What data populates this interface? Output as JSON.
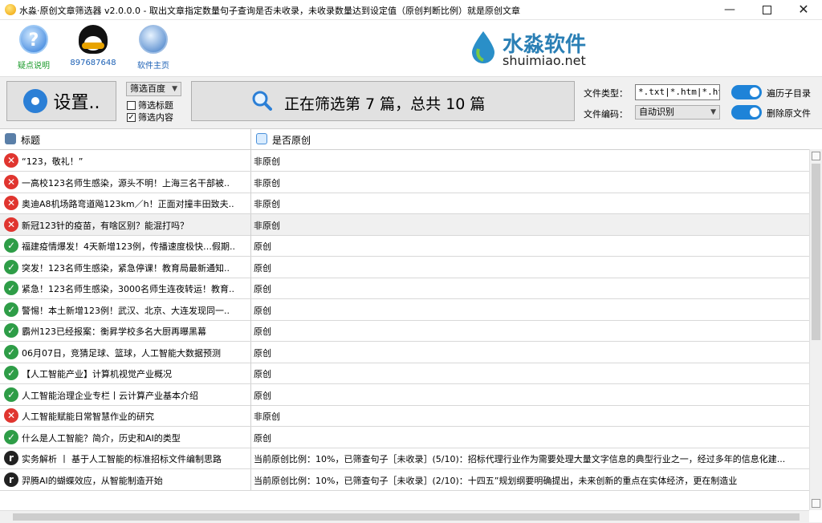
{
  "window": {
    "title": "水淼·原创文章筛选器 v2.0.0.0 - 取出文章指定数量句子查询是否未收录，未收录数量达到设定值（原创判断比例）就是原创文章"
  },
  "toolbar": {
    "items": [
      {
        "label": "疑点说明",
        "icon": "help-icon",
        "color": "#1a9a2a"
      },
      {
        "label": "897687648",
        "icon": "qq-penguin-icon",
        "color": "#1a5fb4"
      },
      {
        "label": "软件主页",
        "icon": "globe-icon",
        "color": "#1a5fb4"
      }
    ],
    "logo": {
      "cn": "水淼软件",
      "en": "shuimiao.net"
    }
  },
  "controls": {
    "settings_label": "设置..",
    "engine_select": "筛选百度",
    "check_title": {
      "label": "筛选标题",
      "checked": false,
      "mark": ""
    },
    "check_content": {
      "label": "筛选内容",
      "checked": true,
      "mark": "✓"
    },
    "status": "正在筛选第 7 篇，总共 10 篇",
    "file_type_label": "文件类型：",
    "file_type_value": "*.txt|*.htm|*.ht",
    "file_encoding_label": "文件编码：",
    "file_encoding_value": "自动识别",
    "toggle_subdirs": {
      "label": "遍历子目录",
      "on": true
    },
    "toggle_delete": {
      "label": "删除原文件",
      "on": true
    }
  },
  "grid": {
    "headers": [
      "标题",
      "是否原创"
    ],
    "rows": [
      {
        "status": "bad",
        "title": "“123，敬礼！”",
        "result": "非原创"
      },
      {
        "status": "bad",
        "title": "一高校123名师生感染，源头不明！上海三名干部被..",
        "result": "非原创"
      },
      {
        "status": "bad",
        "title": "奥迪A8机场路弯道飚123km／h！正面对撞丰田致夫..",
        "result": "非原创"
      },
      {
        "status": "bad",
        "title": "新冠123针的疫苗，有啥区别？能混打吗？",
        "result": "非原创"
      },
      {
        "status": "good",
        "title": "福建疫情爆发！4天新增123例，传播速度极快…假期..",
        "result": "原创"
      },
      {
        "status": "good",
        "title": "突发！123名师生感染，紧急停课！教育局最新通知..",
        "result": "原创"
      },
      {
        "status": "good",
        "title": "紧急！123名师生感染，3000名师生连夜转运！教育..",
        "result": "原创"
      },
      {
        "status": "good",
        "title": "警惕！本土新增123例！武汉、北京、大连发现同一..",
        "result": "原创"
      },
      {
        "status": "good",
        "title": "霸州123已经报案：衡昇学校多名大厨再曝黑幕",
        "result": "原创"
      },
      {
        "status": "good",
        "title": "06月07日，竞猜足球、篮球，人工智能大数据预测",
        "result": "原创"
      },
      {
        "status": "good",
        "title": "【人工智能产业】计算机视觉产业概况",
        "result": "原创"
      },
      {
        "status": "good",
        "title": "人工智能治理企业专栏丨云计算产业基本介绍",
        "result": "原创"
      },
      {
        "status": "bad",
        "title": "人工智能赋能日常智慧作业的研究",
        "result": "非原创"
      },
      {
        "status": "good",
        "title": "什么是人工智能？简介，历史和AI的类型",
        "result": "原创"
      },
      {
        "status": "info",
        "title": "实务解析 丨 基于人工智能的标准招标文件编制思路",
        "result": "当前原创比例：10%，已筛查句子［未收录］(5/10)：招标代理行业作为需要处理大量文字信息的典型行业之一，经过多年的信息化建..."
      },
      {
        "status": "info",
        "title": "羿腾AI的蝴蝶效应，从智能制造开始",
        "result": "当前原创比例：10%，已筛查句子［未收录］(2/10)：十四五”规划纲要明确提出，未来创新的重点在实体经济，更在制造业"
      }
    ]
  }
}
